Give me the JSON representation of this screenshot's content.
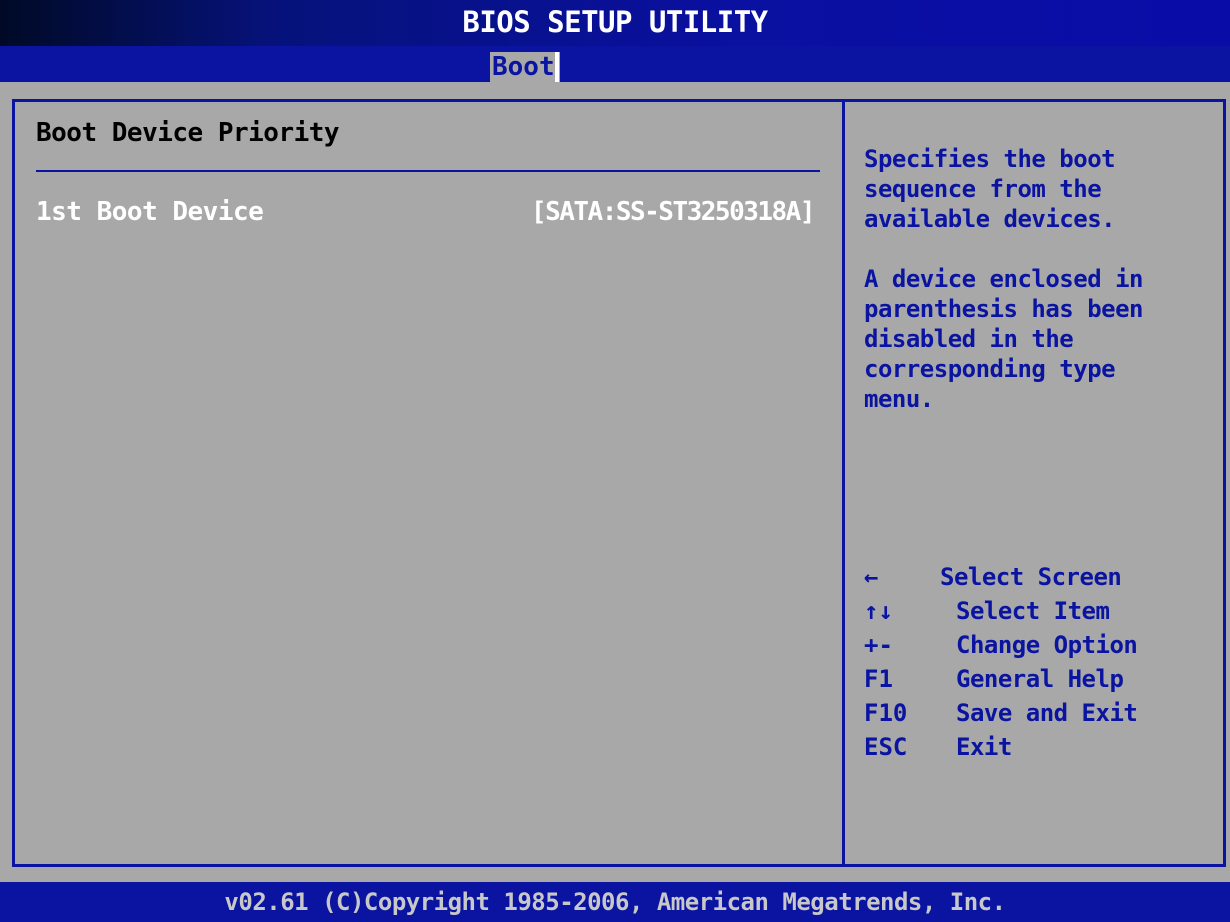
{
  "header": {
    "title": "BIOS SETUP UTILITY",
    "active_tab": "Boot"
  },
  "main": {
    "section_title": "Boot Device Priority",
    "settings": [
      {
        "label": "1st Boot Device",
        "value": "[SATA:SS-ST3250318A]"
      }
    ]
  },
  "help": {
    "paragraph_1": "Specifies the boot\nsequence from the\navailable devices.",
    "paragraph_2": "A device enclosed in\nparenthesis has been\ndisabled in the\ncorresponding type\nmenu."
  },
  "keys": [
    {
      "key": "←",
      "desc": "Select Screen",
      "icon": "arrow-left-icon"
    },
    {
      "key": "↑↓",
      "desc": "Select Item",
      "icon": "arrow-up-down-icon"
    },
    {
      "key": "+-",
      "desc": "Change Option",
      "icon": "plus-minus-icon"
    },
    {
      "key": "F1",
      "desc": "General Help"
    },
    {
      "key": "F10",
      "desc": "Save and Exit"
    },
    {
      "key": "ESC",
      "desc": "Exit"
    }
  ],
  "footer": {
    "text": "v02.61 (C)Copyright 1985-2006, American Megatrends, Inc."
  },
  "colors": {
    "background": "#a8a8a8",
    "accent_blue": "#0a14a0",
    "text_white": "#ffffff"
  }
}
